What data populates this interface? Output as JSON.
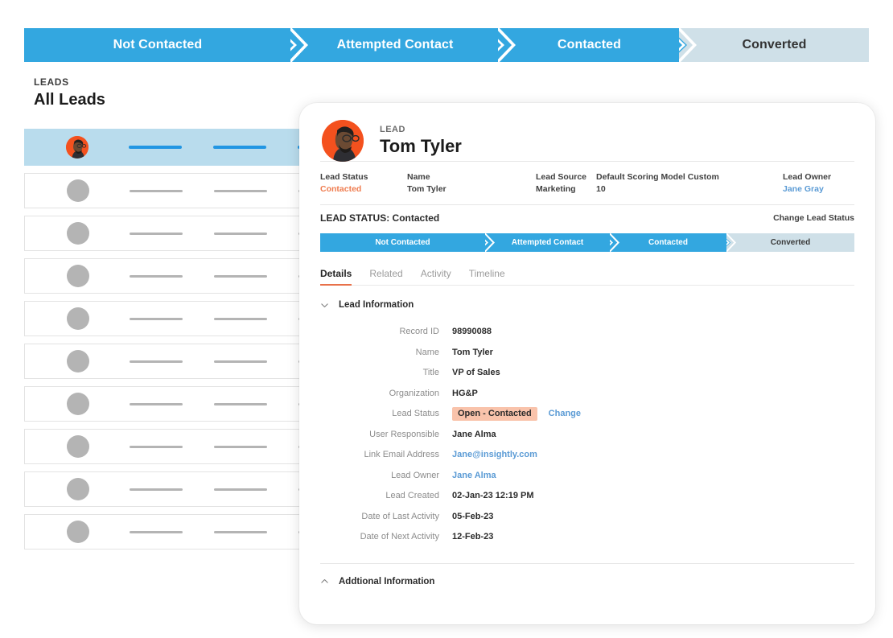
{
  "top_pipeline": {
    "stages": [
      {
        "label": "Not Contacted",
        "state": "done"
      },
      {
        "label": "Attempted Contact",
        "state": "done"
      },
      {
        "label": "Contacted",
        "state": "done"
      },
      {
        "label": "Converted",
        "state": "inactive"
      }
    ]
  },
  "leads_panel": {
    "eyebrow": "LEADS",
    "title": "All Leads",
    "row_count": 10,
    "selected_row_index": 0
  },
  "detail_card": {
    "header": {
      "eyebrow": "LEAD",
      "name": "Tom Tyler",
      "avatar": "lead-photo"
    },
    "summary": [
      {
        "label": "Lead Status",
        "value": "Contacted",
        "style": "orange"
      },
      {
        "label": "Name",
        "value": "Tom Tyler",
        "style": "plain"
      },
      {
        "label": "Lead Source",
        "value": "Marketing",
        "style": "plain"
      },
      {
        "label": "Default Scoring Model Custom",
        "value": "10",
        "style": "plain"
      },
      {
        "label": "Lead Owner",
        "value": "Jane Gray",
        "style": "blue"
      }
    ],
    "status_bar": {
      "label": "LEAD STATUS: Contacted",
      "change_label": "Change Lead Status"
    },
    "inner_pipeline": {
      "stages": [
        {
          "label": "Not Contacted",
          "state": "done"
        },
        {
          "label": "Attempted Contact",
          "state": "done"
        },
        {
          "label": "Contacted",
          "state": "done"
        },
        {
          "label": "Converted",
          "state": "inactive"
        }
      ]
    },
    "tabs": [
      {
        "label": "Details",
        "active": true
      },
      {
        "label": "Related",
        "active": false
      },
      {
        "label": "Activity",
        "active": false
      },
      {
        "label": "Timeline",
        "active": false
      }
    ],
    "lead_information": {
      "section_title": "Lead Information",
      "expanded": true,
      "fields": [
        {
          "label": "Record ID",
          "value": "98990088",
          "style": "plain"
        },
        {
          "label": "Name",
          "value": "Tom Tyler",
          "style": "plain"
        },
        {
          "label": "Title",
          "value": "VP of Sales",
          "style": "plain"
        },
        {
          "label": "Organization",
          "value": "HG&P",
          "style": "plain"
        },
        {
          "label": "Lead Status",
          "value": "Open - Contacted",
          "style": "pill",
          "action": "Change"
        },
        {
          "label": "User Responsible",
          "value": "Jane Alma",
          "style": "plain"
        },
        {
          "label": "Link Email Address",
          "value": "Jane@insightly.com",
          "style": "link"
        },
        {
          "label": "Lead Owner",
          "value": "Jane Alma",
          "style": "link"
        },
        {
          "label": "Lead Created",
          "value": "02-Jan-23 12:19 PM",
          "style": "plain"
        },
        {
          "label": "Date of Last Activity",
          "value": "05-Feb-23",
          "style": "plain"
        },
        {
          "label": "Date of Next Activity",
          "value": "12-Feb-23",
          "style": "plain"
        }
      ]
    },
    "additional_information": {
      "section_title": "Addtional Information",
      "expanded": false
    }
  },
  "colors": {
    "pipeline_active": "#33a7e0",
    "pipeline_inactive": "#cfe0e8",
    "accent_orange": "#f4511e",
    "tab_underline": "#e8714a",
    "link_blue": "#5b9bd5",
    "pill_bg": "#f9c3ab",
    "row_selected_bg": "#b9dced",
    "row_selected_dash": "#2196e3",
    "skeleton_gray": "#b4b4b4"
  }
}
